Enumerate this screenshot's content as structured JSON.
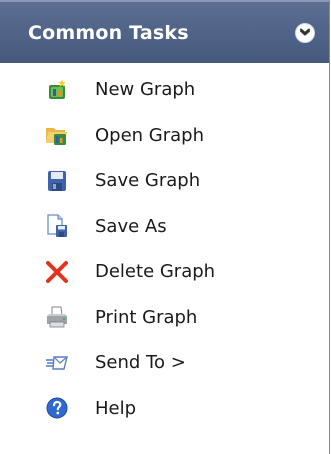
{
  "panel": {
    "title": "Common Tasks",
    "header_color": "#4f6288",
    "items": [
      {
        "label": "New Graph",
        "icon": "new-graph-icon"
      },
      {
        "label": "Open Graph",
        "icon": "open-graph-icon"
      },
      {
        "label": "Save Graph",
        "icon": "save-icon"
      },
      {
        "label": "Save As",
        "icon": "save-as-icon"
      },
      {
        "label": "Delete Graph",
        "icon": "delete-icon"
      },
      {
        "label": "Print Graph",
        "icon": "printer-icon"
      },
      {
        "label": "Send To >",
        "icon": "send-to-icon"
      },
      {
        "label": "Help",
        "icon": "help-icon"
      }
    ]
  }
}
